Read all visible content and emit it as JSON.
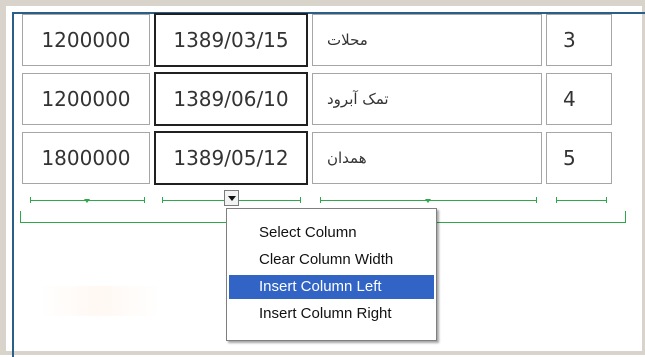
{
  "table": {
    "rows": [
      {
        "amount": "1200000",
        "date": "1389/03/15",
        "name": "محلات",
        "index": "3"
      },
      {
        "amount": "1200000",
        "date": "1389/06/10",
        "name": "تمک آبرود",
        "index": "4"
      },
      {
        "amount": "1800000",
        "date": "1389/05/12",
        "name": "همدان",
        "index": "5"
      }
    ]
  },
  "context_menu": {
    "items": [
      {
        "label": "Select Column",
        "selected": false
      },
      {
        "label": "Clear Column Width",
        "selected": false
      },
      {
        "label": "Insert Column Left",
        "selected": true
      },
      {
        "label": "Insert Column Right",
        "selected": false
      }
    ]
  },
  "colors": {
    "ruler": "#2ea84a",
    "menu_highlight": "#3164c4",
    "frame_accent": "#2b5f87"
  },
  "icons": {
    "column_menu_toggle": "dropdown-arrow-icon"
  }
}
